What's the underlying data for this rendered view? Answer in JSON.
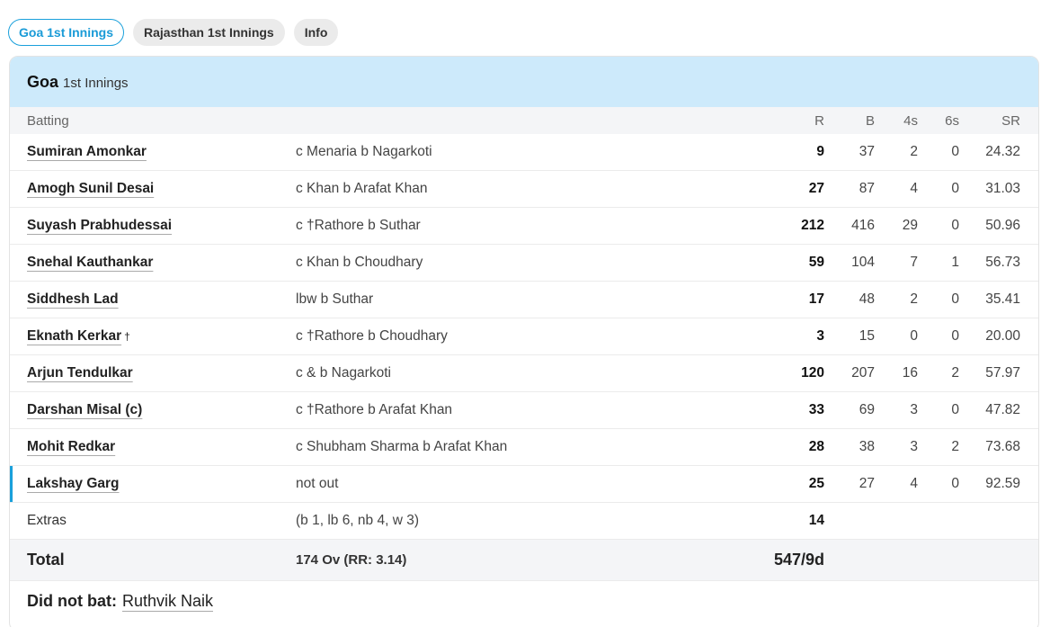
{
  "tabs": [
    {
      "label": "Goa 1st Innings",
      "active": true
    },
    {
      "label": "Rajasthan 1st Innings",
      "active": false
    },
    {
      "label": "Info",
      "active": false
    }
  ],
  "innings": {
    "team": "Goa",
    "label": "1st Innings"
  },
  "columns": {
    "batting": "Batting",
    "r": "R",
    "b": "B",
    "fours": "4s",
    "sixes": "6s",
    "sr": "SR"
  },
  "batters": [
    {
      "name": "Sumiran Amonkar",
      "dismissal": "c Menaria b Nagarkoti",
      "r": "9",
      "b": "37",
      "fours": "2",
      "sixes": "0",
      "sr": "24.32"
    },
    {
      "name": "Amogh Sunil Desai",
      "dismissal": "c Khan b Arafat Khan",
      "r": "27",
      "b": "87",
      "fours": "4",
      "sixes": "0",
      "sr": "31.03"
    },
    {
      "name": "Suyash Prabhudessai",
      "dismissal": "c †Rathore b Suthar",
      "r": "212",
      "b": "416",
      "fours": "29",
      "sixes": "0",
      "sr": "50.96"
    },
    {
      "name": "Snehal Kauthankar",
      "dismissal": "c Khan b Choudhary",
      "r": "59",
      "b": "104",
      "fours": "7",
      "sixes": "1",
      "sr": "56.73"
    },
    {
      "name": "Siddhesh Lad",
      "dismissal": "lbw b Suthar",
      "r": "17",
      "b": "48",
      "fours": "2",
      "sixes": "0",
      "sr": "35.41"
    },
    {
      "name": "Eknath Kerkar",
      "suffix": "†",
      "dismissal": "c †Rathore b Choudhary",
      "r": "3",
      "b": "15",
      "fours": "0",
      "sixes": "0",
      "sr": "20.00"
    },
    {
      "name": "Arjun Tendulkar",
      "dismissal": "c & b Nagarkoti",
      "r": "120",
      "b": "207",
      "fours": "16",
      "sixes": "2",
      "sr": "57.97"
    },
    {
      "name": "Darshan Misal (c)",
      "dismissal": "c †Rathore b Arafat Khan",
      "r": "33",
      "b": "69",
      "fours": "3",
      "sixes": "0",
      "sr": "47.82"
    },
    {
      "name": "Mohit Redkar",
      "dismissal": "c Shubham Sharma b Arafat Khan",
      "r": "28",
      "b": "38",
      "fours": "3",
      "sixes": "2",
      "sr": "73.68"
    },
    {
      "name": "Lakshay Garg",
      "dismissal": "not out",
      "r": "25",
      "b": "27",
      "fours": "4",
      "sixes": "0",
      "sr": "92.59",
      "not_out": true
    }
  ],
  "extras": {
    "label": "Extras",
    "detail": "(b 1, lb 6, nb 4, w 3)",
    "runs": "14"
  },
  "total": {
    "label": "Total",
    "overs": "174 Ov (RR: 3.14)",
    "score": "547/9d"
  },
  "did_not_bat": {
    "label": "Did not bat:",
    "names": "Ruthvik Naik"
  },
  "colors": {
    "accent": "#1aa0db",
    "header_bg": "#cdeafb",
    "row_alt": "#f4f5f7"
  }
}
